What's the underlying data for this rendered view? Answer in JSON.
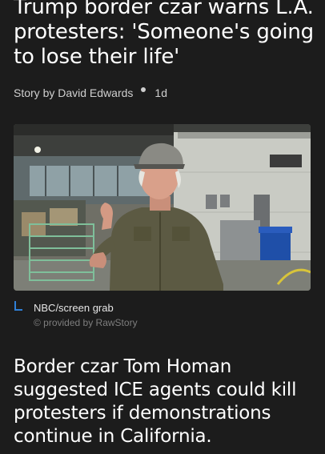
{
  "article": {
    "headline": "Trump border czar warns L.A. protesters: 'Someone's going to lose their life'",
    "author": "Story by David Edwards",
    "age": "1d"
  },
  "image": {
    "credit": "NBC/screen grab",
    "provided_by": "© provided by RawStory"
  },
  "body": {
    "first_paragraph": "Border czar Tom Homan suggested ICE agents could kill protesters if demonstrations continue in California."
  }
}
